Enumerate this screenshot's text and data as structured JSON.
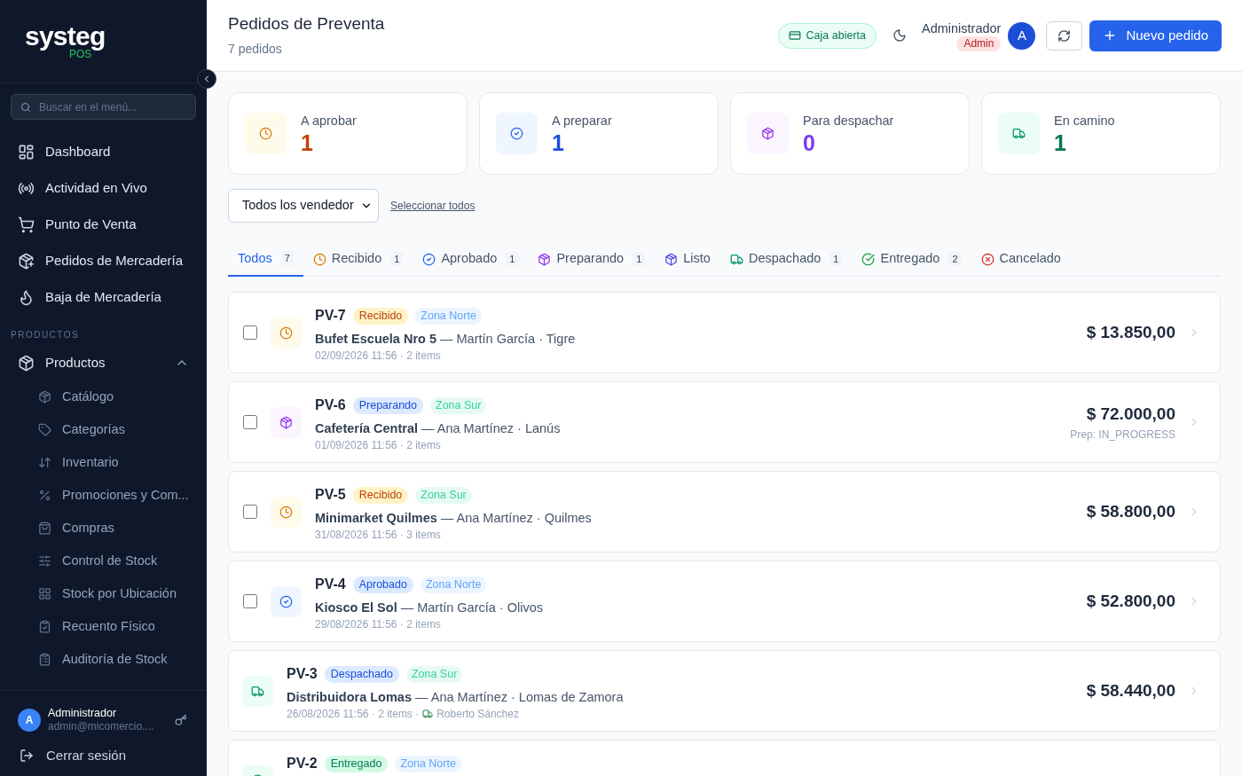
{
  "sidebar": {
    "logo": "systeg",
    "logo_sub": "POS",
    "search": {
      "placeholder": "Buscar en el menú..."
    },
    "items": [
      {
        "label": "Dashboard"
      },
      {
        "label": "Actividad en Vivo"
      },
      {
        "label": "Punto de Venta"
      },
      {
        "label": "Pedidos de Mercadería"
      },
      {
        "label": "Baja de Mercadería"
      }
    ],
    "section": "PRODUCTOS",
    "group": {
      "label": "Productos",
      "expanded": true,
      "children": [
        {
          "label": "Catálogo"
        },
        {
          "label": "Categorías"
        },
        {
          "label": "Inventario"
        },
        {
          "label": "Promociones y Com..."
        },
        {
          "label": "Compras"
        },
        {
          "label": "Control de Stock"
        },
        {
          "label": "Stock por Ubicación"
        },
        {
          "label": "Recuento Físico"
        },
        {
          "label": "Auditoría de Stock"
        }
      ]
    },
    "user": {
      "initial": "A",
      "name": "Administrador",
      "email": "admin@micomercio...."
    },
    "logout": "Cerrar sesión"
  },
  "header": {
    "title": "Pedidos de Preventa",
    "subtitle": "7 pedidos",
    "cash": "Caja abierta",
    "user_name": "Administrador",
    "role": "Admin",
    "avatar": "A",
    "new_button": "Nuevo pedido"
  },
  "stats": [
    {
      "label": "A aprobar",
      "value": "1",
      "kind": "clock"
    },
    {
      "label": "A preparar",
      "value": "1",
      "kind": "check"
    },
    {
      "label": "Para despachar",
      "value": "0",
      "kind": "package"
    },
    {
      "label": "En camino",
      "value": "1",
      "kind": "truck"
    }
  ],
  "filters": {
    "seller": "Todos los vendedor",
    "select_all": "Seleccionar todos"
  },
  "tabs": [
    {
      "label": "Todos",
      "count": "7",
      "kind": "none",
      "selected": true
    },
    {
      "label": "Recibido",
      "count": "1",
      "kind": "clock",
      "selected": false
    },
    {
      "label": "Aprobado",
      "count": "1",
      "kind": "check",
      "selected": false
    },
    {
      "label": "Preparando",
      "count": "1",
      "kind": "package",
      "selected": false
    },
    {
      "label": "Listo",
      "kind": "listo",
      "selected": false
    },
    {
      "label": "Despachado",
      "count": "1",
      "kind": "truck",
      "selected": false
    },
    {
      "label": "Entregado",
      "count": "2",
      "kind": "done",
      "selected": false
    },
    {
      "label": "Cancelado",
      "kind": "cancel",
      "selected": false
    }
  ],
  "orders": [
    {
      "id": "PV-7",
      "kind": "clock",
      "status": "Recibido",
      "zone": "Zona Norte",
      "color": "#60a5fa",
      "client": "Bufet Escuela Nro 5",
      "detail": "— Martín García · Tigre",
      "meta": "02/09/2026 11:56 · 2 items",
      "amount": "$ 13.850,00",
      "checked": false
    },
    {
      "id": "PV-6",
      "kind": "package",
      "status": "Preparando",
      "zone": "Zona Sur",
      "color": "#34d399",
      "client": "Cafetería Central",
      "detail": "— Ana Martínez · Lanús",
      "meta": "01/09/2026 11:56 · 2 items",
      "amount": "$ 72.000,00",
      "note": "Prep: IN_PROGRESS",
      "checked": false
    },
    {
      "id": "PV-5",
      "kind": "clock",
      "status": "Recibido",
      "zone": "Zona Sur",
      "color": "#34d399",
      "client": "Minimarket Quilmes",
      "detail": "— Ana Martínez · Quilmes",
      "meta": "31/08/2026 11:56 · 3 items",
      "amount": "$ 58.800,00",
      "checked": false
    },
    {
      "id": "PV-4",
      "kind": "check",
      "status": "Aprobado",
      "zone": "Zona Norte",
      "color": "#60a5fa",
      "client": "Kiosco El Sol",
      "detail": "— Martín García · Olivos",
      "meta": "29/08/2026 11:56 · 2 items",
      "amount": "$ 52.800,00",
      "checked": false
    },
    {
      "id": "PV-3",
      "kind": "truck",
      "status": "Despachado",
      "zone": "Zona Sur",
      "color": "#34d399",
      "client": "Distribuidora Lomas",
      "detail": "— Ana Martínez · Lomas de Zamora",
      "meta": "26/08/2026 11:56 · 2 items ·",
      "driver": "Roberto Sánchez",
      "amount": "$ 58.440,00"
    },
    {
      "id": "PV-2",
      "kind": "done",
      "status": "Entregado",
      "zone": "Zona Norte",
      "color": "#60a5fa"
    }
  ]
}
